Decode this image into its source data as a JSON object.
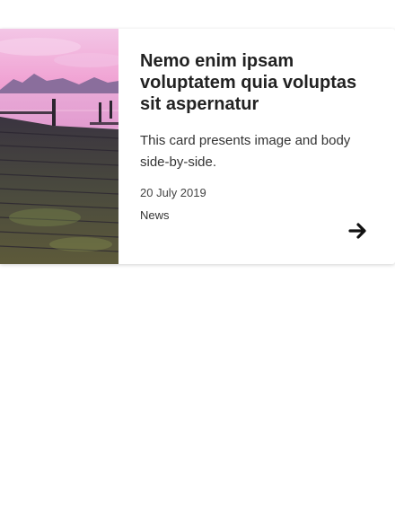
{
  "card": {
    "image": "pier-sunset-image",
    "title": "Nemo enim ipsam voluptatem quia voluptas sit aspernatur",
    "description": "This card presents image and body side-by-side.",
    "date": "20 July 2019",
    "tag": "News",
    "arrow_icon": "arrow-right-icon"
  }
}
